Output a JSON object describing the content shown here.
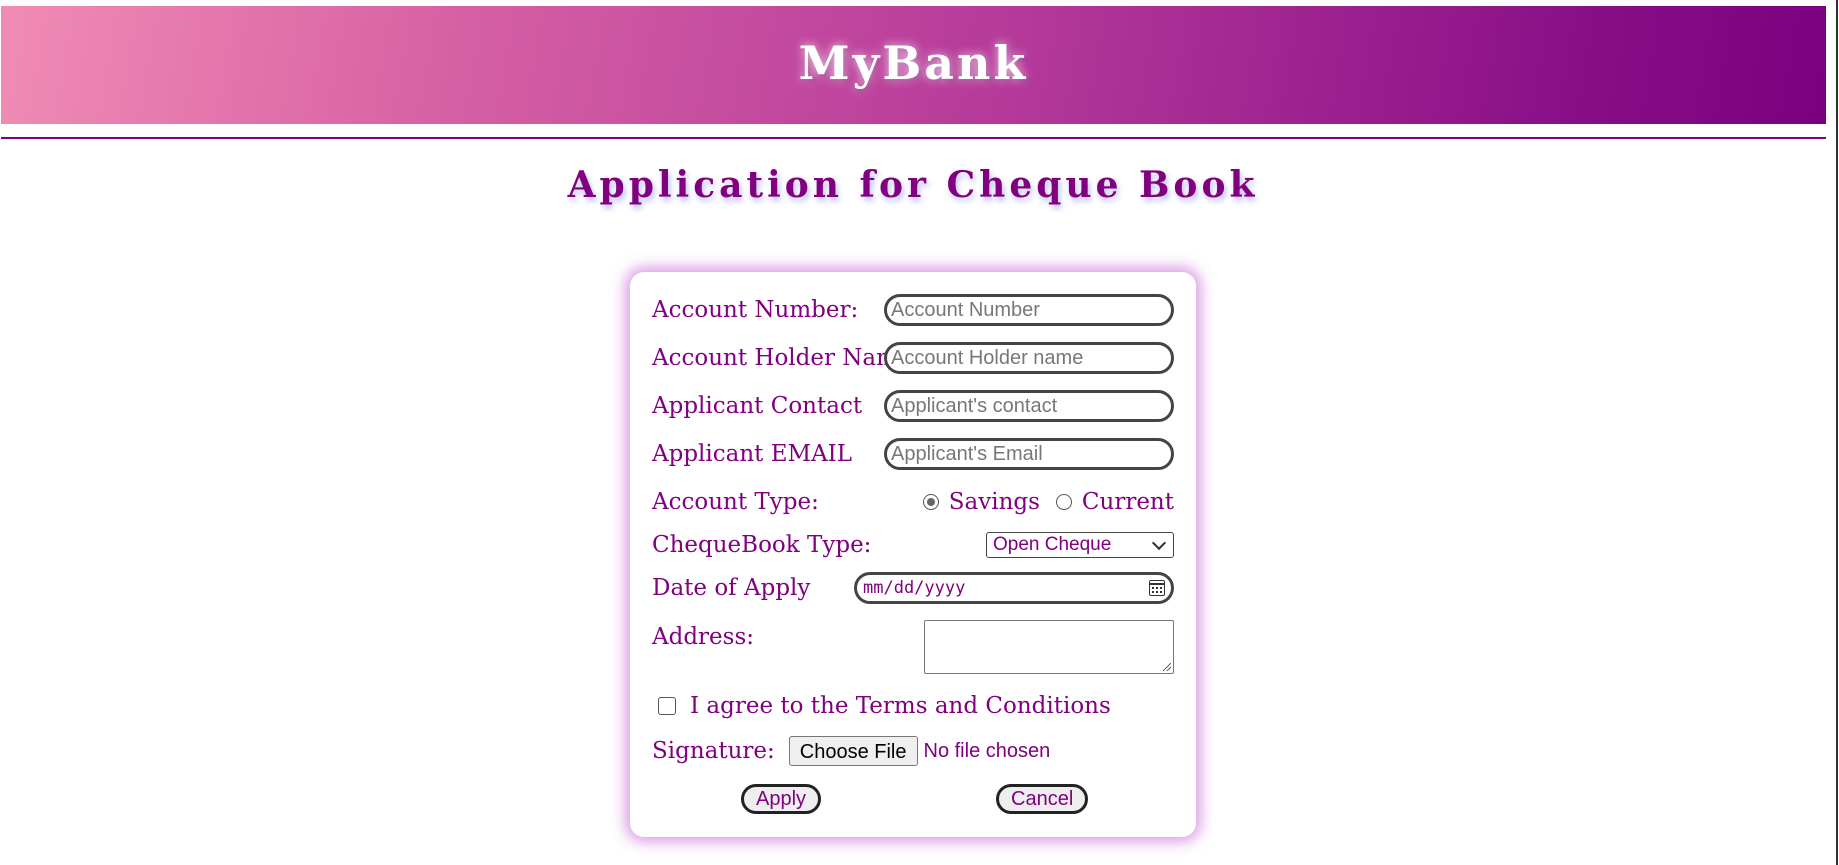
{
  "header": {
    "brand": "MyBank"
  },
  "page": {
    "title": "Application for Cheque Book"
  },
  "form": {
    "account_number": {
      "label": "Account Number:",
      "placeholder": "Account Number",
      "value": ""
    },
    "account_holder": {
      "label": "Account Holder Name:",
      "placeholder": "Account Holder name",
      "value": ""
    },
    "contact": {
      "label": "Applicant Contact",
      "placeholder": "Applicant's contact",
      "value": ""
    },
    "email": {
      "label": "Applicant EMAIL",
      "placeholder": "Applicant's Email",
      "value": ""
    },
    "account_type": {
      "label": "Account Type:",
      "options": [
        "Savings",
        "Current"
      ],
      "selected": "Savings"
    },
    "chequebook_type": {
      "label": "ChequeBook Type:",
      "selected": "Open Cheque"
    },
    "date_of_apply": {
      "label": "Date of Apply",
      "placeholder": "mm/dd/yyyy"
    },
    "address": {
      "label": "Address:",
      "value": ""
    },
    "terms": {
      "label": "I agree to the Terms and Conditions",
      "checked": false
    },
    "signature": {
      "label": "Signature:",
      "button_label": "Choose File",
      "status": "No file chosen"
    },
    "buttons": {
      "apply": "Apply",
      "cancel": "Cancel"
    }
  },
  "colors": {
    "brand_purple": "#800080",
    "banner_start": "#f08cb4",
    "banner_end": "#7a0080"
  }
}
